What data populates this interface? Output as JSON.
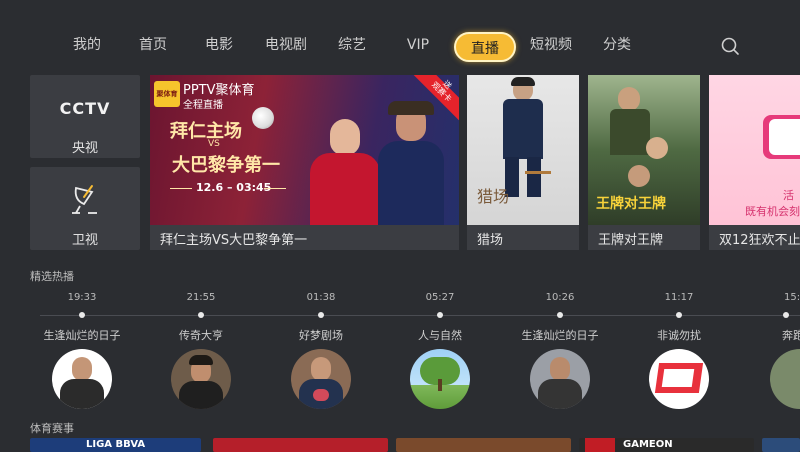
{
  "nav": {
    "items": [
      "我的",
      "首页",
      "电影",
      "电视剧",
      "综艺",
      "VIP",
      "直播",
      "短视频",
      "分类"
    ],
    "active": "直播",
    "search_icon": "search-icon"
  },
  "channels": [
    {
      "logo": "CCTV",
      "label": "央视",
      "icon": "cctv-logo"
    },
    {
      "label": "卫视",
      "icon": "satellite-dish-icon"
    }
  ],
  "featured": {
    "brand": "PPTV聚体育",
    "brand_badge": "聚体育",
    "brand_sub": "全程直播",
    "corner_badge": "送\n观赛卡",
    "headline_1": "拜仁主场",
    "headline_vs": "VS",
    "headline_2": "大巴黎争第一",
    "time": "12.6 – 03:45",
    "caption": "拜仁主场VS大巴黎争第一"
  },
  "cards": [
    {
      "caption": "猎场",
      "poster_text": "猎场"
    },
    {
      "caption": "王牌对王牌",
      "poster_text": "王牌对王牌"
    },
    {
      "caption": "双12狂欢不止",
      "poster_text_1": "活",
      "poster_text_2": "既有机会刻"
    }
  ],
  "hot": {
    "title": "精选热播",
    "items": [
      {
        "time": "19:33",
        "name": "生逢灿烂的日子"
      },
      {
        "time": "21:55",
        "name": "传奇大亨"
      },
      {
        "time": "01:38",
        "name": "好梦剧场"
      },
      {
        "time": "05:27",
        "name": "人与自然"
      },
      {
        "time": "10:26",
        "name": "生逢灿烂的日子"
      },
      {
        "time": "11:17",
        "name": "非诚勿扰"
      },
      {
        "time": "15:",
        "name": "奔跑"
      }
    ]
  },
  "sports": {
    "title": "体育赛事",
    "strip_1": "LIGA BBVA",
    "strip_3": "GAMEON"
  },
  "colors": {
    "accent": "#f6bb34",
    "background": "#2b2d31",
    "tile": "#3b3d42"
  }
}
